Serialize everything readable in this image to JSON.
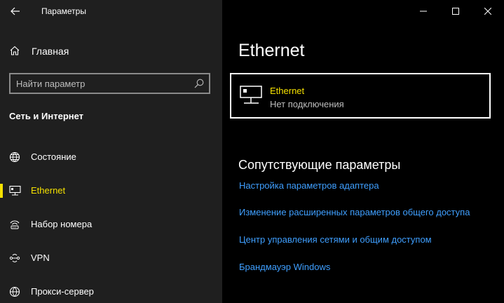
{
  "window": {
    "title": "Параметры",
    "controls": [
      "minimize-icon",
      "maximize-icon",
      "close-icon"
    ]
  },
  "sidebar": {
    "home_label": "Главная",
    "search": {
      "placeholder": "Найти параметр",
      "value": ""
    },
    "section_title": "Сеть и Интернет",
    "items": [
      {
        "label": "Состояние",
        "icon": "globe-icon",
        "active": false
      },
      {
        "label": "Ethernet",
        "icon": "ethernet-icon",
        "active": true
      },
      {
        "label": "Набор номера",
        "icon": "dialup-icon",
        "active": false
      },
      {
        "label": "VPN",
        "icon": "vpn-icon",
        "active": false
      },
      {
        "label": "Прокси-сервер",
        "icon": "globe-icon",
        "active": false
      }
    ]
  },
  "main": {
    "title": "Ethernet",
    "adapter": {
      "name": "Ethernet",
      "status": "Нет подключения",
      "icon": "ethernet-icon"
    },
    "related_title": "Сопутствующие параметры",
    "links": [
      "Настройка параметров адаптера",
      "Изменение расширенных параметров общего доступа",
      "Центр управления сетями и общим доступом",
      "Брандмауэр Windows"
    ]
  },
  "colors": {
    "accent": "#f5e100",
    "link": "#3f9fff",
    "sidebar_bg": "#1f1f1f",
    "main_bg": "#000000"
  }
}
